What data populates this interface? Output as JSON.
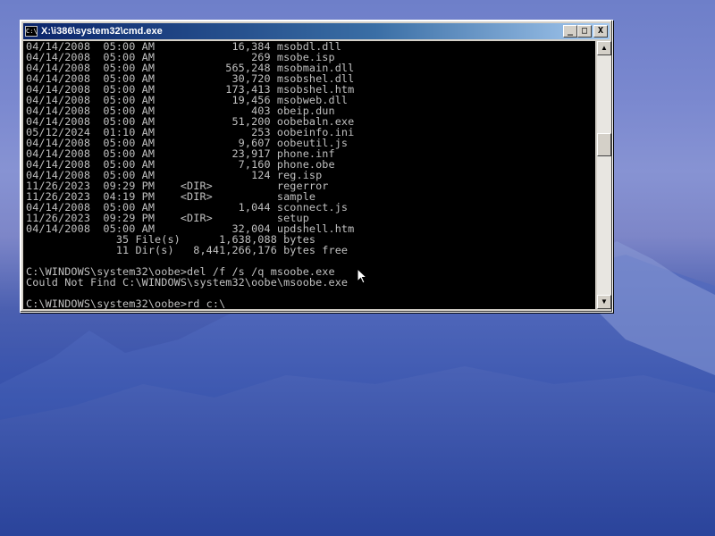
{
  "window": {
    "title": "X:\\i386\\system32\\cmd.exe",
    "icon": "console-icon",
    "buttons": {
      "minimize": "_",
      "maximize": "□",
      "close": "X"
    }
  },
  "console": {
    "lines": [
      "04/14/2008  05:00 AM            16,384 msobdl.dll",
      "04/14/2008  05:00 AM               269 msobe.isp",
      "04/14/2008  05:00 AM           565,248 msobmain.dll",
      "04/14/2008  05:00 AM            30,720 msobshel.dll",
      "04/14/2008  05:00 AM           173,413 msobshel.htm",
      "04/14/2008  05:00 AM            19,456 msobweb.dll",
      "04/14/2008  05:00 AM               403 obeip.dun",
      "04/14/2008  05:00 AM            51,200 oobebaln.exe",
      "05/12/2024  01:10 AM               253 oobeinfo.ini",
      "04/14/2008  05:00 AM             9,607 oobeutil.js",
      "04/14/2008  05:00 AM            23,917 phone.inf",
      "04/14/2008  05:00 AM             7,160 phone.obe",
      "04/14/2008  05:00 AM               124 reg.isp",
      "11/26/2023  09:29 PM    <DIR>          regerror",
      "11/26/2023  04:19 PM    <DIR>          sample",
      "04/14/2008  05:00 AM             1,044 sconnect.js",
      "11/26/2023  09:29 PM    <DIR>          setup",
      "04/14/2008  05:00 AM            32,004 updshell.htm",
      "              35 File(s)      1,638,088 bytes",
      "              11 Dir(s)   8,441,266,176 bytes free",
      "",
      "C:\\WINDOWS\\system32\\oobe>del /f /s /q msoobe.exe",
      "Could Not Find C:\\WINDOWS\\system32\\oobe\\msoobe.exe",
      "",
      "C:\\WINDOWS\\system32\\oobe>rd c:\\"
    ]
  },
  "scrollbar": {
    "up_arrow": "▲",
    "down_arrow": "▼"
  }
}
